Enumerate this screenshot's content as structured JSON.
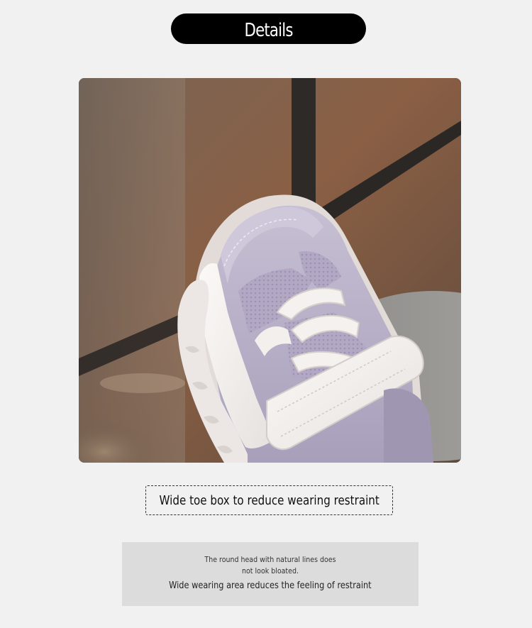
{
  "header": {
    "title": "Details"
  },
  "product_image": {
    "subject": "toddler-sneaker-toe-closeup"
  },
  "feature": {
    "caption": "Wide toe box to reduce wearing restraint"
  },
  "description": {
    "line1": "The round head with natural lines does not look bloated.",
    "line2": "Wide wearing area reduces the feeling of restraint"
  },
  "colors": {
    "background": "#f1f1f1",
    "pill": "#000000",
    "panel": "#dcdcdc",
    "shoe_lavender": "#b6acc6",
    "shoe_white": "#f6f3f1"
  }
}
